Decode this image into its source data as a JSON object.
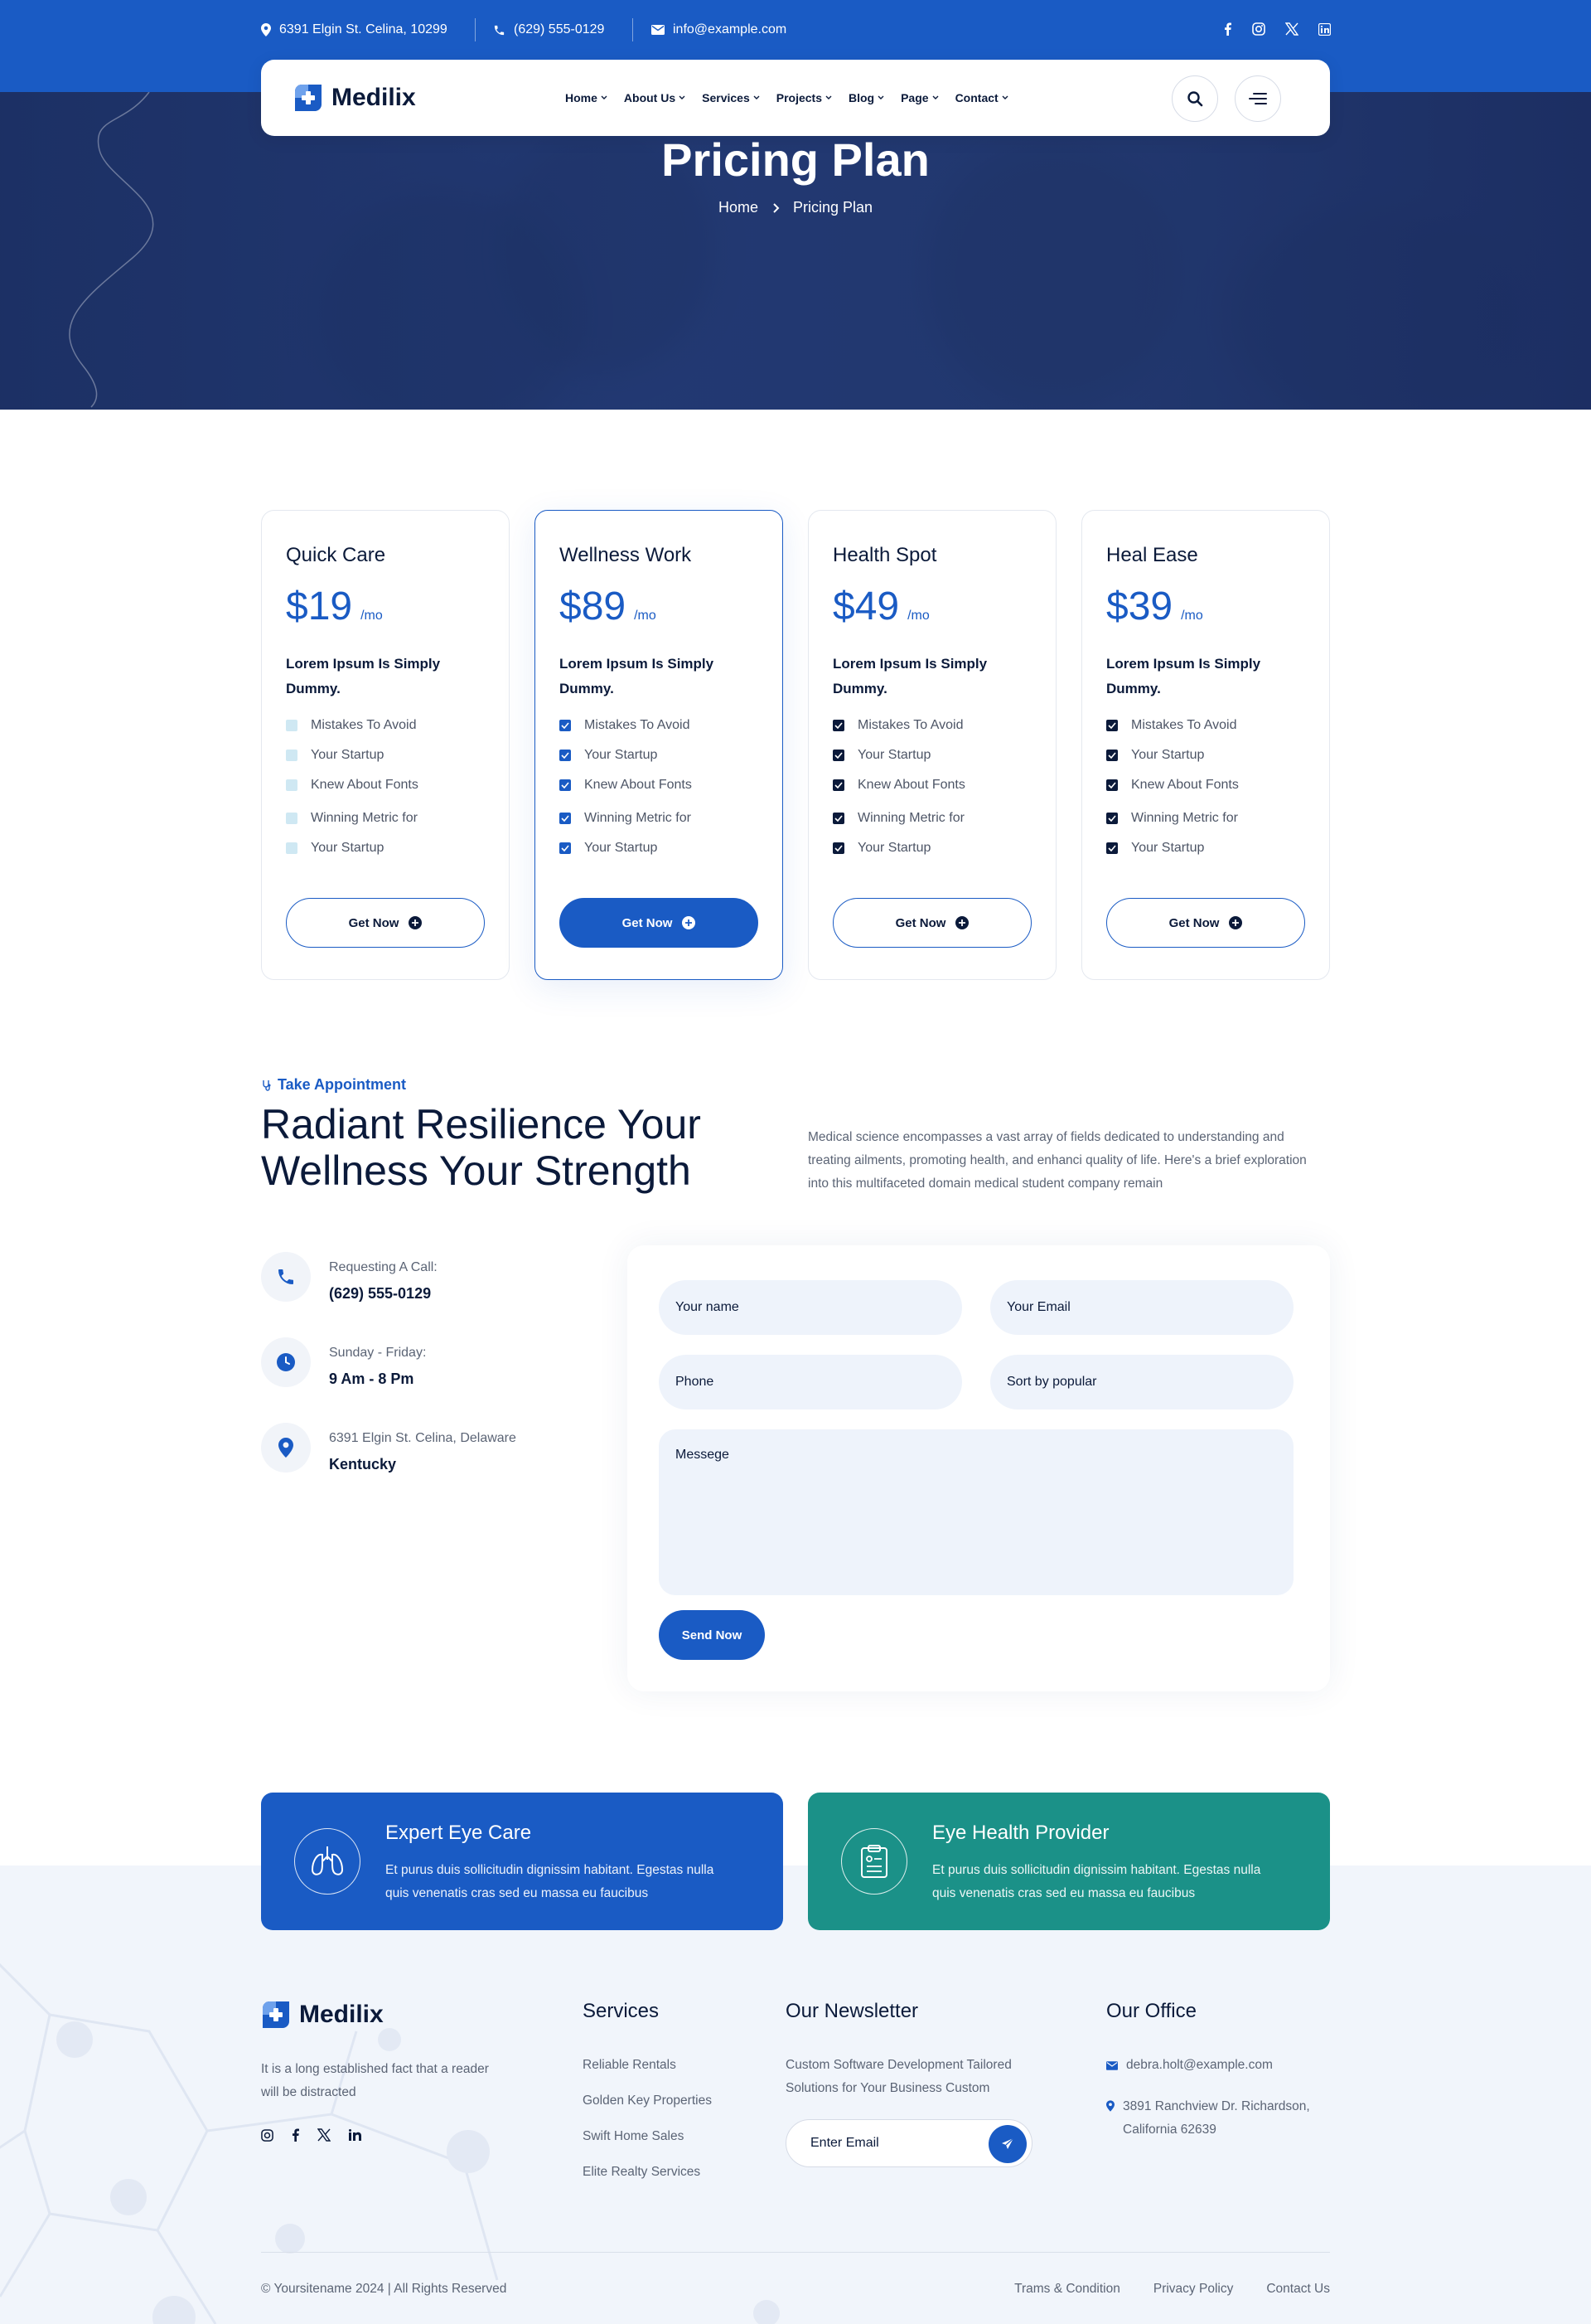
{
  "topbar": {
    "address": "6391 Elgin St. Celina, 10299",
    "phone": "(629) 555-0129",
    "email": "info@example.com",
    "social": [
      "facebook-icon",
      "instagram-icon",
      "x-icon",
      "linkedin-icon"
    ]
  },
  "nav": {
    "brand": "Medilix",
    "menu": [
      {
        "label": "Home"
      },
      {
        "label": "About Us"
      },
      {
        "label": "Services"
      },
      {
        "label": "Projects"
      },
      {
        "label": "Blog"
      },
      {
        "label": "Page"
      },
      {
        "label": "Contact"
      }
    ]
  },
  "hero": {
    "title": "Pricing Plan",
    "breadcrumb_home": "Home",
    "breadcrumb_current": "Pricing Plan"
  },
  "pricing": {
    "features": [
      "Mistakes To Avoid",
      "Your Startup",
      "Knew About Fonts",
      "Winning Metric for",
      "Your Startup"
    ],
    "plans": [
      {
        "name": "Quick Care",
        "price": "$19",
        "per": "/mo",
        "subtitle": "Lorem Ipsum Is Simply Dummy.",
        "button": "Get Now"
      },
      {
        "name": "Wellness Work",
        "price": "$89",
        "per": "/mo",
        "subtitle": "Lorem Ipsum Is Simply Dummy.",
        "button": "Get Now"
      },
      {
        "name": "Health Spot",
        "price": "$49",
        "per": "/mo",
        "subtitle": "Lorem Ipsum Is Simply Dummy.",
        "button": "Get Now"
      },
      {
        "name": "Heal Ease",
        "price": "$39",
        "per": "/mo",
        "subtitle": "Lorem Ipsum Is Simply Dummy.",
        "button": "Get Now"
      }
    ]
  },
  "appointment": {
    "tag": "Take Appointment",
    "title": "Radiant Resilience Your Wellness Your Strength",
    "description": "Medical science encompasses a vast array of fields dedicated to understanding and treating ailments, promoting health, and enhanci quality of life. Here's a brief exploration into this multifaceted domain medical student company remain",
    "info": [
      {
        "label": "Requesting A Call:",
        "value": "(629) 555-0129"
      },
      {
        "label": "Sunday - Friday:",
        "value": "9 Am - 8 Pm"
      },
      {
        "label": "6391 Elgin St. Celina, Delaware",
        "value": "Kentucky"
      }
    ],
    "form": {
      "name": "Your name",
      "email": "Your Email",
      "phone": "Phone",
      "sort": "Sort by popular",
      "message": "Messege",
      "submit": "Send Now"
    }
  },
  "banners": [
    {
      "title": "Expert Eye Care",
      "text": "Et purus duis sollicitudin dignissim habitant. Egestas nulla quis venenatis cras sed eu massa eu faucibus",
      "color": "#1a5bc4"
    },
    {
      "title": "Eye Health Provider",
      "text": "Et purus duis sollicitudin dignissim habitant. Egestas nulla quis venenatis cras sed eu massa eu faucibus",
      "color": "#1b9188"
    }
  ],
  "footer": {
    "brand": "Medilix",
    "about": "It is a long established fact that a reader will be distracted",
    "services_title": "Services",
    "services": [
      "Reliable Rentals",
      "Golden Key Properties",
      "Swift Home Sales",
      "Elite Realty Services"
    ],
    "newsletter_title": "Our Newsletter",
    "newsletter_text": "Custom Software Development Tailored Solutions for Your Business Custom",
    "newsletter_placeholder": "Enter Email",
    "office_title": "Our Office",
    "office_email": "debra.holt@example.com",
    "office_address": "3891 Ranchview Dr. Richardson, California 62639",
    "copyright": "© Yoursitename  2024 | All Rights Reserved",
    "links": [
      "Trams & Condition",
      "Privacy Policy",
      "Contact Us"
    ]
  },
  "colors": {
    "primary": "#1a5bc4",
    "teal": "#1b9188",
    "navy": "#0b1a3a"
  }
}
